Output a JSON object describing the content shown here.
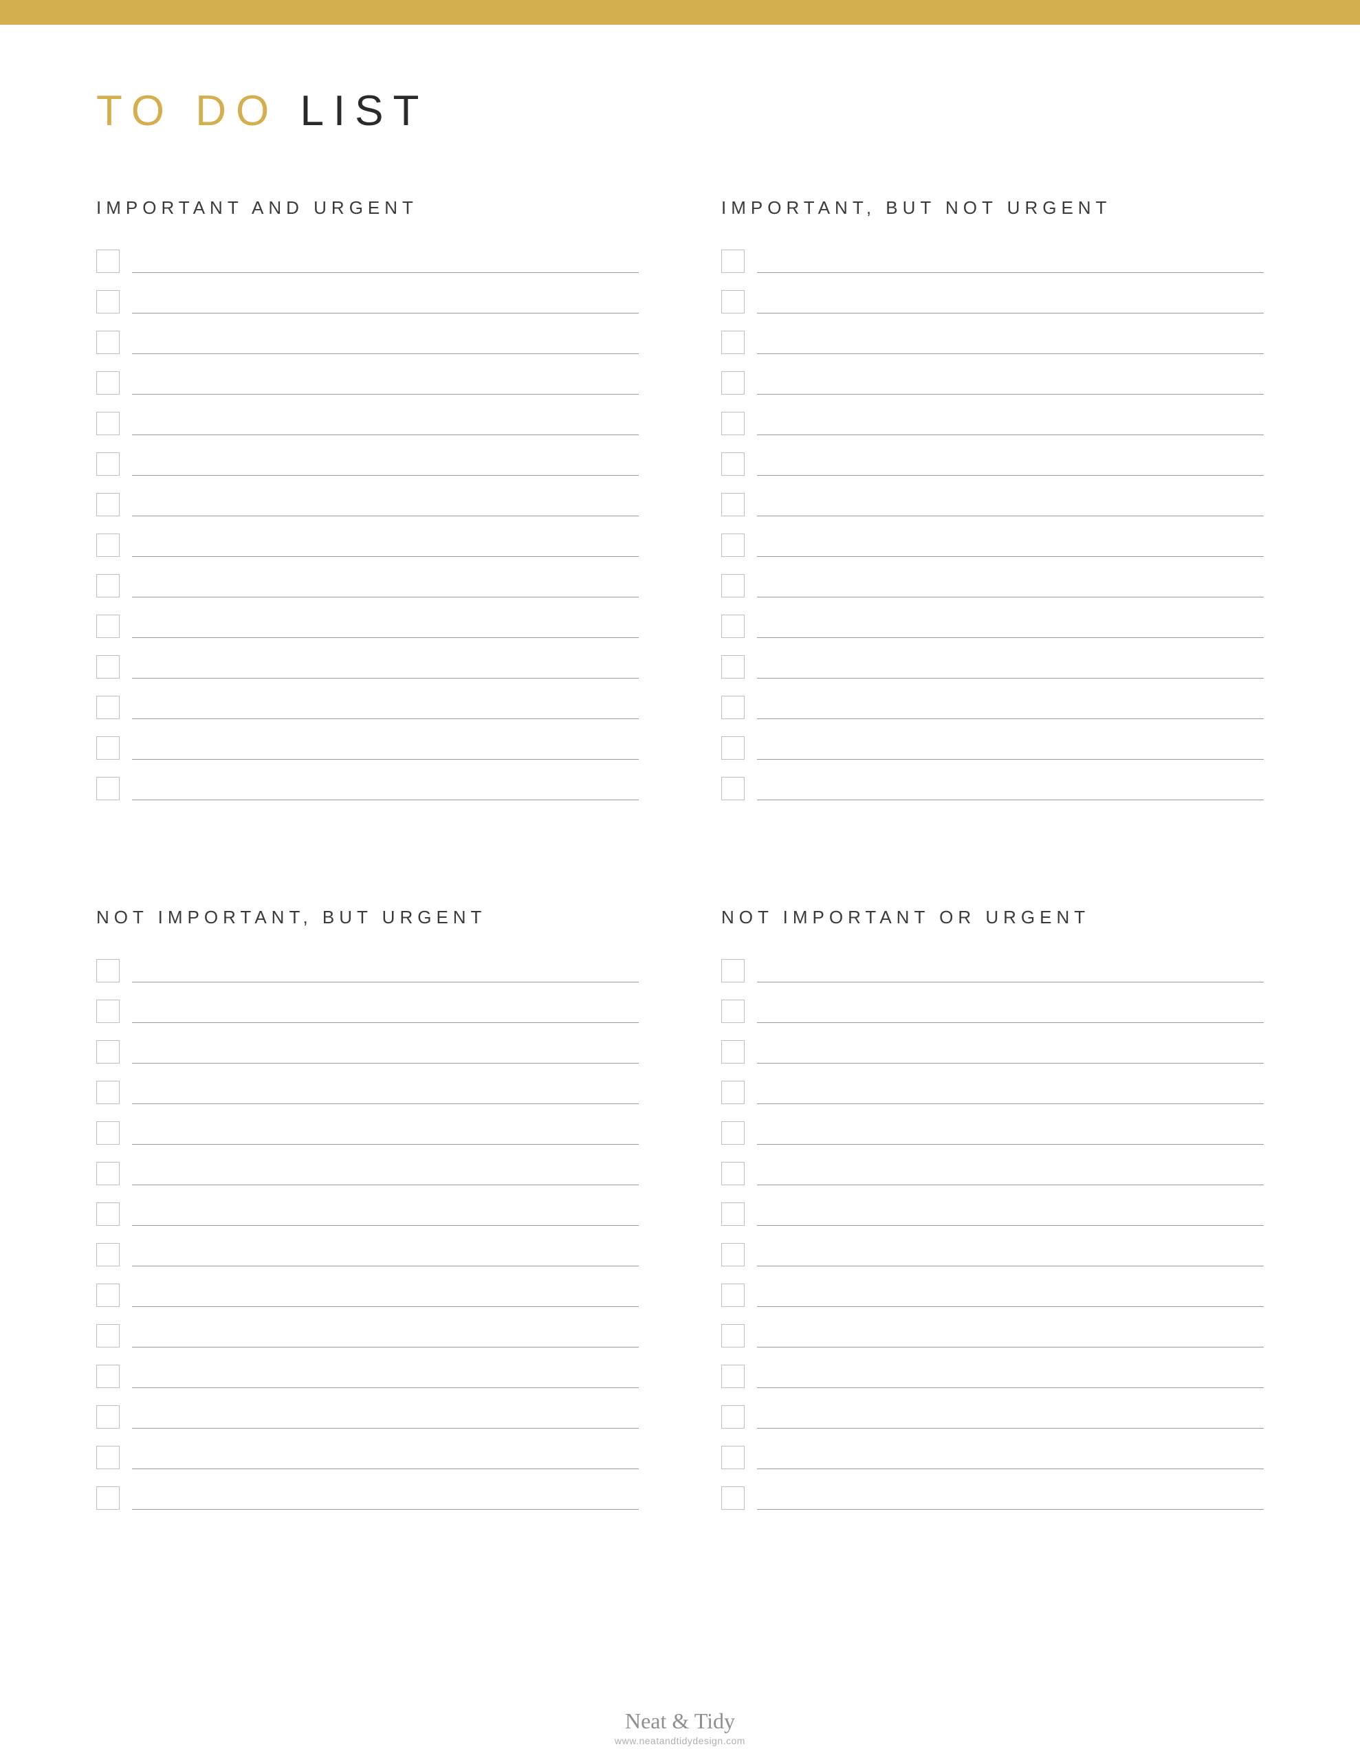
{
  "title": {
    "accent": "TO DO",
    "rest": "LIST"
  },
  "quadrants": [
    {
      "heading": "IMPORTANT AND URGENT",
      "rows": 14
    },
    {
      "heading": "IMPORTANT, BUT NOT URGENT",
      "rows": 14
    },
    {
      "heading": "NOT IMPORTANT, BUT URGENT",
      "rows": 14
    },
    {
      "heading": "NOT IMPORTANT OR URGENT",
      "rows": 14
    }
  ],
  "footer": {
    "brand": "Neat & Tidy",
    "url": "www.neatandtidydesign.com"
  },
  "colors": {
    "accent": "#d4af4f",
    "heading": "#3a3a3a",
    "checkbox_border": "#bfbfbf",
    "line": "#9a9a9a"
  }
}
